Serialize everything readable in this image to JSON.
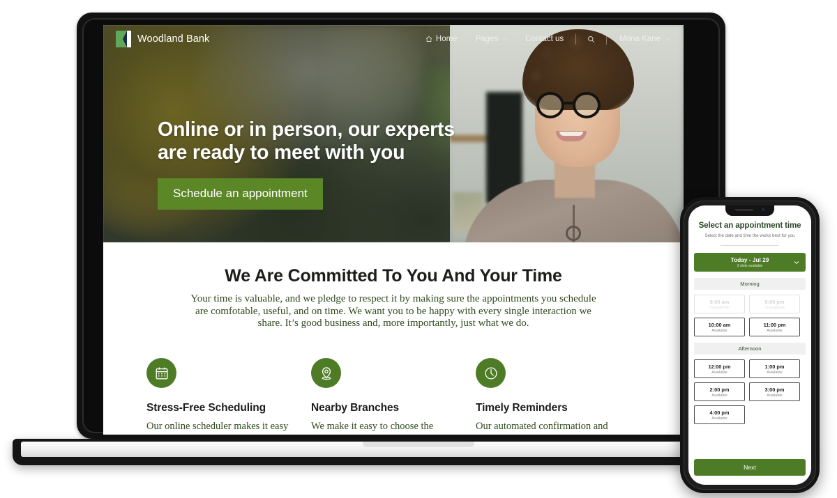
{
  "site": {
    "brand_name": "Woodland Bank",
    "brand_logo_icon": "woodland-chevron-logo",
    "nav": [
      {
        "label": "Home",
        "icon": "home-icon",
        "has_caret": false
      },
      {
        "label": "Pages",
        "icon": "",
        "has_caret": true
      },
      {
        "label": "Contact us",
        "icon": "",
        "has_caret": false
      }
    ],
    "search_icon": "search-icon",
    "user": {
      "name": "Mona Kane",
      "caret_icon": "chevron-down-icon"
    }
  },
  "hero": {
    "heading_line1": "Online or in person, our experts",
    "heading_line2": "are ready to meet with you",
    "cta_label": "Schedule an appointment"
  },
  "commit": {
    "heading": "We Are Committed To You And Your Time",
    "paragraph": "Your time is valuable, and we pledge to respect it by making sure the appointments you schedule are comfotable, useful, and on time. We want you to be happy with every single interaction we share. It’s good business and, more importantly, just what we do."
  },
  "features": [
    {
      "icon": "calendar-icon",
      "title": "Stress-Free Scheduling",
      "body": "Our online scheduler makes it easy to get the meeting time"
    },
    {
      "icon": "map-pin-icon",
      "title": "Nearby Branches",
      "body": "We make it easy to choose the location to meet that is"
    },
    {
      "icon": "clock-icon",
      "title": "Timely Reminders",
      "body": "Our automated confirmation and reminder messages helps"
    }
  ],
  "phone": {
    "title": "Select an appointment time",
    "subtitle": "Select the date and time the works best for you",
    "date_selector": {
      "label": "Today - Jul 29",
      "sub_label": "3 slots available",
      "caret_icon": "chevron-down-icon"
    },
    "sections": [
      {
        "name": "Morning",
        "slots": [
          {
            "time": "8:00 am",
            "state": "Unavailable",
            "available": false
          },
          {
            "time": "9:00 pm",
            "state": "Unavailable",
            "available": false
          },
          {
            "time": "10:00 am",
            "state": "Available",
            "available": true
          },
          {
            "time": "11:00 pm",
            "state": "Available",
            "available": true
          }
        ]
      },
      {
        "name": "Afternoon",
        "slots": [
          {
            "time": "12:00 pm",
            "state": "Available",
            "available": true
          },
          {
            "time": "1:00 pm",
            "state": "Available",
            "available": true
          },
          {
            "time": "2:00 pm",
            "state": "Available",
            "available": true
          },
          {
            "time": "3:00 pm",
            "state": "Available",
            "available": true
          },
          {
            "time": "4:00 pm",
            "state": "Available",
            "available": true
          }
        ]
      }
    ],
    "next_label": "Next"
  },
  "colors": {
    "brand_green": "#4e7c26",
    "cta_green": "#5c8727",
    "body_text_green": "#2f4a1c",
    "heading_dark": "#1d1d1b"
  }
}
